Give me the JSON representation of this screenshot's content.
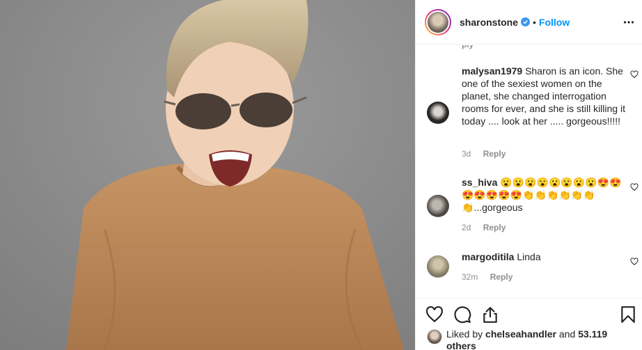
{
  "post": {
    "username": "sharonstone",
    "follow_label": "Follow",
    "separator": "•"
  },
  "clipped_reply": "ply",
  "comments": [
    {
      "user": "malysan1979",
      "text": "Sharon is an icon. She one of the sexiest women on the planet, she changed interrogation rooms for ever, and she is still killing it today .... look at her ..... gorgeous!!!!!",
      "age": "3d",
      "reply": "Reply"
    },
    {
      "user": "ss_hiva",
      "text": "😮😮😮😮😮😮😮😮😍😍😍😍😍😍😍👏👏👏👏👏👏👏...gorgeous",
      "age": "2d",
      "reply": "Reply"
    },
    {
      "user": "margoditila",
      "text": "Linda",
      "age": "32m",
      "reply": "Reply"
    }
  ],
  "likes": {
    "prefix": "Liked by",
    "user": "chelseahandler",
    "conjunction": "and",
    "others": "53.119 others"
  },
  "icons": [
    "verified-badge-icon",
    "more-options-icon",
    "heart-icon",
    "comment-icon",
    "share-icon",
    "bookmark-icon"
  ],
  "colors": {
    "link": "#0095f6",
    "muted": "#8e8e8e",
    "photo_bg": "#8b8b8b",
    "sweater": "#c08a5c"
  }
}
